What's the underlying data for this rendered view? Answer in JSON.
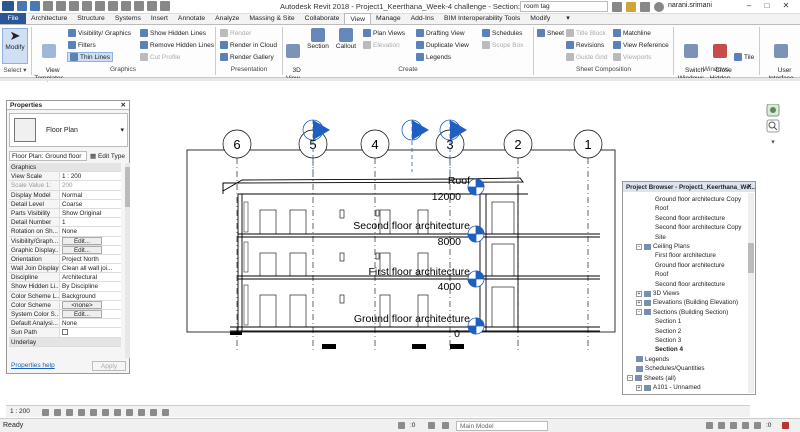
{
  "window": {
    "title": "Autodesk Revit 2018 -    Project1_Keerthana_Week-4 challenge - Section: Section 4",
    "search_text": "room tag",
    "user": "narani.srimani"
  },
  "tabs": [
    "File",
    "Architecture",
    "Structure",
    "Systems",
    "Insert",
    "Annotate",
    "Analyze",
    "Massing & Site",
    "Collaborate",
    "View",
    "Manage",
    "Add-Ins",
    "BIM Interoperability Tools",
    "Modify"
  ],
  "active_tab": "View",
  "ribbon": {
    "modify": "Modify",
    "select": "Select ▾",
    "view_templates": "View\nTemplates",
    "visibility_graphics": "Visibility/ Graphics",
    "filters": "Filters",
    "thin_lines": "Thin Lines",
    "show_hidden_lines": "Show  Hidden Lines",
    "remove_hidden_lines": "Remove  Hidden Lines",
    "cut_profile": "Cut  Profile",
    "graphics_label": "Graphics",
    "render": "Render",
    "render_in_cloud": "Render  in Cloud",
    "render_gallery": "Render  Gallery",
    "presentation_label": "Presentation",
    "view_3d": "3D\nView",
    "section": "Section",
    "callout": "Callout",
    "plan_views": "Plan  Views",
    "elevation": "Elevation",
    "drafting_view": "Drafting  View",
    "duplicate_view": "Duplicate  View",
    "legends": "Legends",
    "schedules": "Schedules",
    "scope_box": "Scope  Box",
    "create_label": "Create",
    "sheet": "Sheet",
    "title_block": "Title  Block",
    "revisions": "Revisions",
    "guide_grid": "Guide  Grid",
    "matchline": "Matchline",
    "view_reference": "View  Reference",
    "viewports": "Viewports",
    "sheet_composition_label": "Sheet Composition",
    "switch_windows": "Switch\nWindows",
    "close_hidden": "Close\nHidden",
    "tile": "Tile",
    "windows_label": "Windows",
    "user_interface": "User\nInterface"
  },
  "properties": {
    "title": "Properties",
    "type_name": "Floor Plan",
    "instance_selector": "Floor Plan: Ground floor",
    "edit_type": "Edit Type",
    "rows": [
      {
        "k": "Graphics",
        "v": "",
        "group": true
      },
      {
        "k": "View Scale",
        "v": "1 : 200"
      },
      {
        "k": "Scale Value   1:",
        "v": "200",
        "dim": true
      },
      {
        "k": "Display Model",
        "v": "Normal"
      },
      {
        "k": "Detail Level",
        "v": "Coarse"
      },
      {
        "k": "Parts Visibility",
        "v": "Show Original"
      },
      {
        "k": "Detail Number",
        "v": "1"
      },
      {
        "k": "Rotation on Sh...",
        "v": "None"
      },
      {
        "k": "Visibility/Graph...",
        "v": "Edit...",
        "button": true
      },
      {
        "k": "Graphic Display...",
        "v": "Edit...",
        "button": true
      },
      {
        "k": "Orientation",
        "v": "Project North"
      },
      {
        "k": "Wall Join Display",
        "v": "Clean all wall joi..."
      },
      {
        "k": "Discipline",
        "v": "Architectural"
      },
      {
        "k": "Show Hidden Li...",
        "v": "By Discipline"
      },
      {
        "k": "Color Scheme L...",
        "v": "Background"
      },
      {
        "k": "Color Scheme",
        "v": "<none>",
        "button": true
      },
      {
        "k": "System Color S...",
        "v": "Edit...",
        "button": true
      },
      {
        "k": "Default Analysi...",
        "v": "None"
      },
      {
        "k": "Sun Path",
        "v": ""
      },
      {
        "k": "Underlay",
        "v": "",
        "group": true
      }
    ],
    "help_link": "Properties help",
    "apply": "Apply"
  },
  "section": {
    "grid_labels": [
      "6",
      "5",
      "4",
      "3",
      "2",
      "1"
    ],
    "levels": [
      {
        "name": "Roof",
        "elev": "12000"
      },
      {
        "name": "Second floor architecture",
        "elev": "8000"
      },
      {
        "name": "First floor architecture",
        "elev": "4000"
      },
      {
        "name": "Ground floor architecture",
        "elev": "0"
      }
    ]
  },
  "browser": {
    "title": "Project Browser - Project1_Keerthana_We...",
    "items": [
      {
        "label": "Ground floor architecture Copy",
        "indent": 2
      },
      {
        "label": "Roof",
        "indent": 2
      },
      {
        "label": "Second floor architecture",
        "indent": 2
      },
      {
        "label": "Second floor architecture Copy",
        "indent": 2
      },
      {
        "label": "Site",
        "indent": 2
      },
      {
        "label": "Ceiling Plans",
        "indent": 1,
        "toggle": "−"
      },
      {
        "label": "First floor architecture",
        "indent": 2
      },
      {
        "label": "Ground floor architecture",
        "indent": 2
      },
      {
        "label": "Roof",
        "indent": 2
      },
      {
        "label": "Second floor architecture",
        "indent": 2
      },
      {
        "label": "3D Views",
        "indent": 1,
        "toggle": "+"
      },
      {
        "label": "Elevations (Building Elevation)",
        "indent": 1,
        "toggle": "+"
      },
      {
        "label": "Sections (Building Section)",
        "indent": 1,
        "toggle": "−"
      },
      {
        "label": "Section 1",
        "indent": 2
      },
      {
        "label": "Section 2",
        "indent": 2
      },
      {
        "label": "Section 3",
        "indent": 2
      },
      {
        "label": "Section 4",
        "indent": 2,
        "bold": true
      },
      {
        "label": "Legends",
        "indent": 0
      },
      {
        "label": "Schedules/Quantities",
        "indent": 0
      },
      {
        "label": "Sheets (all)",
        "indent": 0,
        "toggle": "−"
      },
      {
        "label": "A101 - Unnamed",
        "indent": 1,
        "toggle": "+"
      }
    ]
  },
  "viewbar": {
    "scale": "1 : 200"
  },
  "status": {
    "ready": "Ready",
    "model": "Main Model",
    "zero_a": ":0",
    "zero_b": ":0"
  },
  "colors": {
    "accent": "#2b5797",
    "grid_blue": "#1f5fc2",
    "level_blue": "#1f5fc2"
  }
}
